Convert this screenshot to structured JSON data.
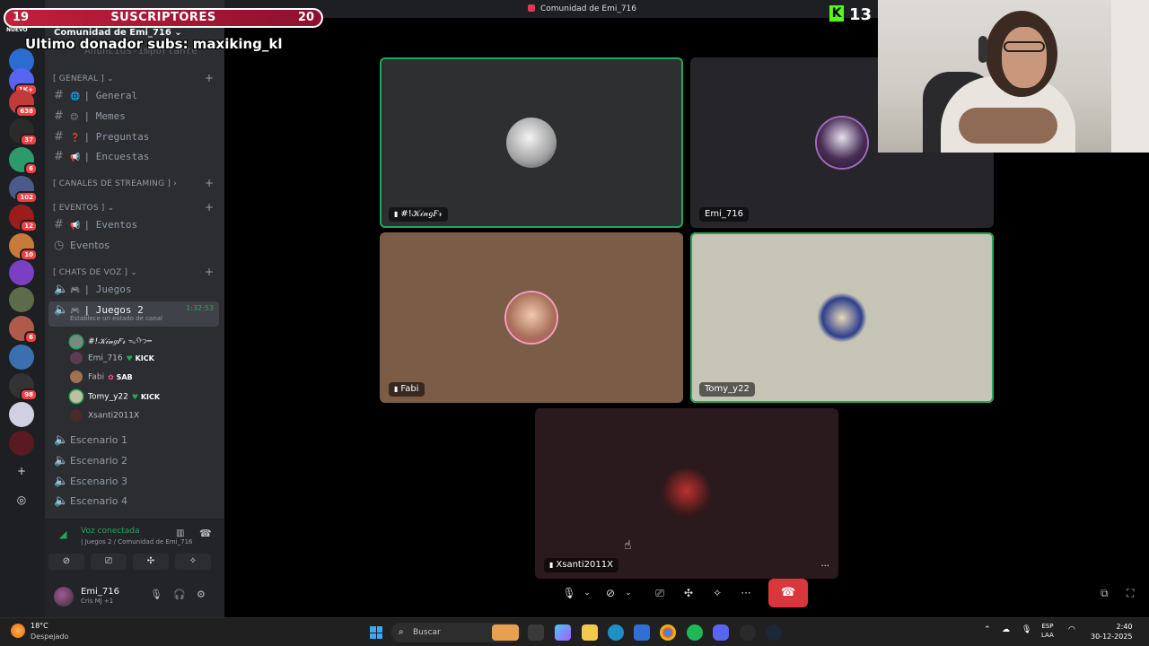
{
  "window": {
    "title": "Comunidad de Emi_716"
  },
  "overlay": {
    "subs_current": "19",
    "subs_label": "SUSCRIPTORES",
    "subs_goal": "20",
    "new_tag": "NUEVO",
    "last_donor": "Ultimo donador subs: maxiking_kl",
    "kick_count": "13",
    "kick_letter": "K"
  },
  "rail": {
    "badges": [
      "1K+",
      "638",
      "37",
      "6",
      "102",
      "12",
      "10",
      "6",
      "98"
    ]
  },
  "server": {
    "name": "Comunidad de Emi_716",
    "connected_channel_hint": "| Juegos 2",
    "faded_channel": "Anuncios-importante"
  },
  "categories": {
    "general": "[ GENERAL ]",
    "streaming": "[ CANALES DE STREAMING ]",
    "eventos": "[ EVENTOS ]",
    "voz": "[ CHATS DE VOZ ]"
  },
  "text_channels": [
    {
      "emoji": "🌐",
      "name": "| General"
    },
    {
      "emoji": "😊",
      "name": "| Memes"
    },
    {
      "emoji": "❓",
      "name": "| Preguntas"
    },
    {
      "emoji": "📢",
      "name": "| Encuestas"
    }
  ],
  "event_channels": [
    {
      "emoji": "📢",
      "name": "| Eventos"
    },
    {
      "emoji": "",
      "name": "Eventos"
    }
  ],
  "voice_channels": {
    "juegos": "| Juegos",
    "juegos2": "| Juegos 2",
    "juegos2_time": "1:32:53",
    "juegos2_status": "Establece un estado de canal",
    "escenarios": [
      "Escenario 1",
      "Escenario 2",
      "Escenario 3",
      "Escenario 4"
    ]
  },
  "members": [
    {
      "name": "#!𝒦𝒾𝓃𝑔𝐹𝓇",
      "tag": "",
      "suffix": "ᯓᡣ𐭩━",
      "color": "#7a8a80"
    },
    {
      "name": "Emi_716",
      "tag": "KICK",
      "suffix": "",
      "color": "#5a3c52"
    },
    {
      "name": "Fabi",
      "tag": "SAB",
      "suffix": "",
      "color": "#a07050"
    },
    {
      "name": "Tomy_y22",
      "tag": "KICK",
      "suffix": "",
      "color": "#c0c0a0"
    },
    {
      "name": "Xsanti2011X",
      "tag": "",
      "suffix": "",
      "color": "#4a2a2a"
    }
  ],
  "voice_panel": {
    "title": "Voz conectada",
    "subtitle": "| Juegos 2 / Comunidad de Emi_716"
  },
  "user_panel": {
    "name": "Emi_716",
    "activity": "Cris MJ +1"
  },
  "tiles": [
    {
      "name": "#!𝒦𝒾𝓃𝑔𝐹𝓇",
      "bg": "#2e2f31",
      "muted": true
    },
    {
      "name": "Emi_716",
      "bg": "#26252a",
      "muted": false
    },
    {
      "name": "Fabi",
      "bg": "#7b5c47",
      "muted": true
    },
    {
      "name": "Tomy_y22",
      "bg": "#c5c4b5",
      "muted": false
    },
    {
      "name": "Xsanti2011X",
      "bg": "#2a1a1d",
      "muted": true
    }
  ],
  "taskbar": {
    "temp": "18°C",
    "weather": "Despejado",
    "search_placeholder": "Buscar",
    "lang_top": "ESP",
    "lang_bottom": "LAA",
    "time": "2:40",
    "date": "30-12-2025"
  },
  "colors": {
    "discord_green": "#23a55a",
    "hangup_red": "#da373c",
    "kick_green": "#53fc18",
    "subs_red": "#c0203a"
  }
}
